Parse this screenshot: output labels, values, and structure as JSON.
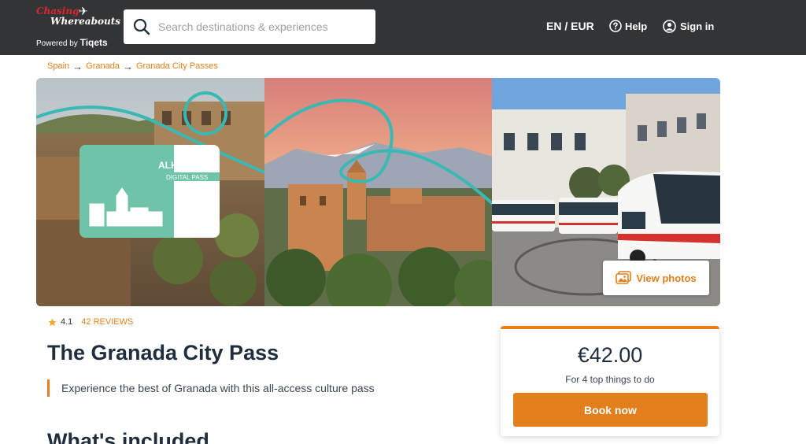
{
  "header": {
    "logo_text_line1": "Chasing",
    "logo_text_line2": "Whereabouts",
    "powered_by_prefix": "Powered by ",
    "powered_by_brand": "Tiqets",
    "search_placeholder": "Search destinations & experiences",
    "search_value": "",
    "language_currency": "EN / EUR",
    "help_label": "Help",
    "signin_label": "Sign in"
  },
  "breadcrumb": {
    "items": [
      "Spain",
      "Granada",
      "Granada City Passes"
    ],
    "separator": "→"
  },
  "gallery": {
    "card_label_line1": "ALHAMBRA",
    "card_label_line2": "DIGITAL PASS",
    "view_photos_label": "View photos"
  },
  "product": {
    "rating": "4.1",
    "reviews_label": "42 reviews",
    "title": "The Granada City Pass",
    "tagline": "Experience the best of Granada with this all-access culture pass",
    "section_heading": "What's included"
  },
  "price_card": {
    "price": "€42.00",
    "subtitle": "For 4 top things to do",
    "cta_label": "Book now"
  },
  "colors": {
    "header_bg": "#333436",
    "accent_orange": "#e37f1c",
    "text_dark": "#1f2d3d",
    "teal": "#3ab8b3",
    "card_green": "#6fc3a9",
    "star": "#f5a623"
  },
  "icons": {
    "search": "search-icon",
    "help": "question-circle-icon",
    "signin": "user-circle-icon",
    "breadcrumb_separator": "arrow-right-icon",
    "view_photos": "images-icon",
    "rating": "star-icon"
  }
}
